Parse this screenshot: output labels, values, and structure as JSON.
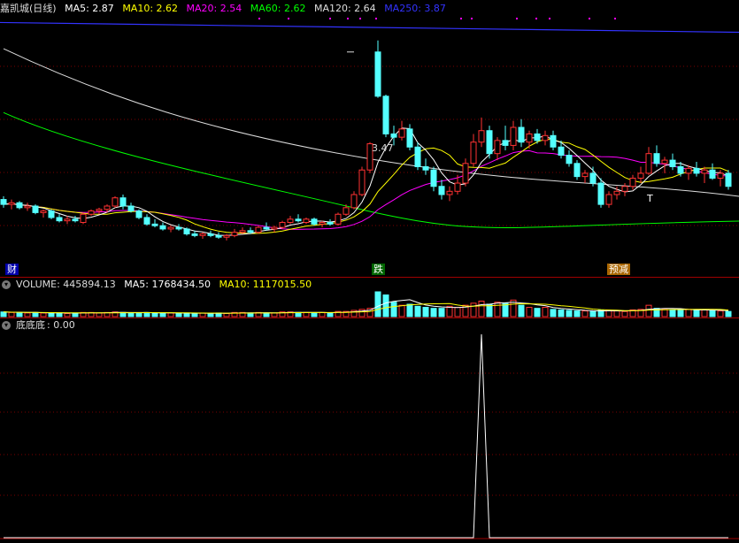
{
  "header": {
    "title": "嘉凯城(日线)",
    "ma": [
      {
        "label": "MA5: 2.87",
        "color": "#ffffff"
      },
      {
        "label": "MA10: 2.62",
        "color": "#ffff00"
      },
      {
        "label": "MA20: 2.54",
        "color": "#ff00ff"
      },
      {
        "label": "MA60: 2.62",
        "color": "#00ff00"
      },
      {
        "label": "MA120: 2.64",
        "color": "#dddddd"
      },
      {
        "label": "MA250: 3.87",
        "color": "#3333ff"
      }
    ]
  },
  "volume_header": {
    "name": "VOLUME: 445894.13",
    "ma5": "MA5: 1768434.50",
    "ma10": "MA10: 1117015.50"
  },
  "indicator_header": {
    "name": "底底底",
    "value": ": 0.00"
  },
  "tags": {
    "cai": "财",
    "die": "跌",
    "yujian": "预减",
    "high_label": "3.47",
    "t_label": "T"
  },
  "colors": {
    "up": "#ff3232",
    "down": "#54ffff",
    "grid": "#7a0000",
    "ma5": "#ffffff",
    "ma10": "#ffff00",
    "ma20": "#ff00ff",
    "ma60": "#00ff00",
    "ma120": "#dddddd",
    "ma250": "#3333ff"
  },
  "chart_data": [
    {
      "type": "candlestick",
      "title": "嘉凯城(日线)",
      "ylim": [
        2.12,
        3.62
      ],
      "candles": [
        [
          2.5,
          2.52,
          2.45,
          2.47
        ],
        [
          2.47,
          2.5,
          2.44,
          2.48
        ],
        [
          2.48,
          2.49,
          2.44,
          2.45
        ],
        [
          2.45,
          2.48,
          2.43,
          2.46
        ],
        [
          2.46,
          2.47,
          2.41,
          2.42
        ],
        [
          2.42,
          2.44,
          2.39,
          2.43
        ],
        [
          2.43,
          2.44,
          2.38,
          2.39
        ],
        [
          2.39,
          2.41,
          2.36,
          2.37
        ],
        [
          2.37,
          2.4,
          2.35,
          2.38
        ],
        [
          2.38,
          2.4,
          2.36,
          2.37
        ],
        [
          2.36,
          2.42,
          2.35,
          2.41
        ],
        [
          2.41,
          2.44,
          2.4,
          2.43
        ],
        [
          2.43,
          2.45,
          2.41,
          2.44
        ],
        [
          2.44,
          2.47,
          2.42,
          2.46
        ],
        [
          2.46,
          2.52,
          2.45,
          2.51
        ],
        [
          2.51,
          2.53,
          2.44,
          2.46
        ],
        [
          2.46,
          2.48,
          2.42,
          2.43
        ],
        [
          2.43,
          2.44,
          2.38,
          2.39
        ],
        [
          2.39,
          2.41,
          2.34,
          2.35
        ],
        [
          2.35,
          2.38,
          2.33,
          2.34
        ],
        [
          2.34,
          2.36,
          2.31,
          2.32
        ],
        [
          2.32,
          2.34,
          2.3,
          2.33
        ],
        [
          2.33,
          2.35,
          2.31,
          2.32
        ],
        [
          2.32,
          2.33,
          2.28,
          2.29
        ],
        [
          2.29,
          2.31,
          2.27,
          2.28
        ],
        [
          2.28,
          2.3,
          2.26,
          2.29
        ],
        [
          2.29,
          2.31,
          2.27,
          2.28
        ],
        [
          2.28,
          2.3,
          2.26,
          2.27
        ],
        [
          2.27,
          2.29,
          2.25,
          2.28
        ],
        [
          2.28,
          2.32,
          2.27,
          2.3
        ],
        [
          2.3,
          2.33,
          2.29,
          2.31
        ],
        [
          2.31,
          2.33,
          2.29,
          2.3
        ],
        [
          2.3,
          2.34,
          2.29,
          2.33
        ],
        [
          2.33,
          2.36,
          2.31,
          2.32
        ],
        [
          2.32,
          2.34,
          2.3,
          2.33
        ],
        [
          2.33,
          2.37,
          2.32,
          2.36
        ],
        [
          2.36,
          2.4,
          2.35,
          2.38
        ],
        [
          2.38,
          2.41,
          2.36,
          2.37
        ],
        [
          2.36,
          2.39,
          2.35,
          2.38
        ],
        [
          2.38,
          2.39,
          2.34,
          2.35
        ],
        [
          2.35,
          2.37,
          2.33,
          2.36
        ],
        [
          2.36,
          2.38,
          2.34,
          2.35
        ],
        [
          2.35,
          2.42,
          2.34,
          2.41
        ],
        [
          2.41,
          2.47,
          2.4,
          2.45
        ],
        [
          2.45,
          2.55,
          2.44,
          2.53
        ],
        [
          2.53,
          2.7,
          2.52,
          2.68
        ],
        [
          2.68,
          2.85,
          2.66,
          2.84
        ],
        [
          3.4,
          3.47,
          3.12,
          3.13
        ],
        [
          3.13,
          3.14,
          2.88,
          2.9
        ],
        [
          2.9,
          2.95,
          2.83,
          2.88
        ],
        [
          2.88,
          2.98,
          2.86,
          2.93
        ],
        [
          2.93,
          2.96,
          2.8,
          2.82
        ],
        [
          2.82,
          2.85,
          2.68,
          2.7
        ],
        [
          2.7,
          2.75,
          2.65,
          2.68
        ],
        [
          2.68,
          2.7,
          2.55,
          2.58
        ],
        [
          2.58,
          2.62,
          2.5,
          2.53
        ],
        [
          2.53,
          2.58,
          2.49,
          2.55
        ],
        [
          2.55,
          2.65,
          2.53,
          2.6
        ],
        [
          2.6,
          2.75,
          2.58,
          2.72
        ],
        [
          2.72,
          2.9,
          2.7,
          2.85
        ],
        [
          2.85,
          3.0,
          2.82,
          2.92
        ],
        [
          2.92,
          2.95,
          2.75,
          2.78
        ],
        [
          2.78,
          2.88,
          2.74,
          2.86
        ],
        [
          2.86,
          2.95,
          2.8,
          2.83
        ],
        [
          2.83,
          2.98,
          2.8,
          2.94
        ],
        [
          2.94,
          2.99,
          2.82,
          2.85
        ],
        [
          2.85,
          2.92,
          2.81,
          2.9
        ],
        [
          2.9,
          2.93,
          2.84,
          2.86
        ],
        [
          2.86,
          2.92,
          2.83,
          2.89
        ],
        [
          2.89,
          2.92,
          2.8,
          2.82
        ],
        [
          2.82,
          2.86,
          2.75,
          2.77
        ],
        [
          2.77,
          2.8,
          2.7,
          2.72
        ],
        [
          2.72,
          2.74,
          2.62,
          2.64
        ],
        [
          2.64,
          2.68,
          2.6,
          2.66
        ],
        [
          2.66,
          2.7,
          2.58,
          2.6
        ],
        [
          2.6,
          2.63,
          2.45,
          2.47
        ],
        [
          2.47,
          2.55,
          2.45,
          2.53
        ],
        [
          2.53,
          2.58,
          2.5,
          2.55
        ],
        [
          2.55,
          2.6,
          2.52,
          2.58
        ],
        [
          2.58,
          2.65,
          2.56,
          2.63
        ],
        [
          2.63,
          2.7,
          2.6,
          2.66
        ],
        [
          2.66,
          2.82,
          2.65,
          2.78
        ],
        [
          2.78,
          2.83,
          2.7,
          2.72
        ],
        [
          2.72,
          2.76,
          2.66,
          2.74
        ],
        [
          2.74,
          2.78,
          2.68,
          2.7
        ],
        [
          2.7,
          2.73,
          2.64,
          2.66
        ],
        [
          2.66,
          2.71,
          2.62,
          2.69
        ],
        [
          2.69,
          2.73,
          2.64,
          2.66
        ],
        [
          2.66,
          2.7,
          2.6,
          2.68
        ],
        [
          2.68,
          2.72,
          2.62,
          2.63
        ],
        [
          2.63,
          2.68,
          2.58,
          2.66
        ],
        [
          2.66,
          2.68,
          2.56,
          2.58
        ]
      ],
      "ma250": [
        3.58,
        3.52
      ],
      "ma120": [
        3.42,
        3.25,
        3.08,
        2.97,
        2.92
      ],
      "ma60": [
        3.03,
        2.93,
        2.75,
        2.62,
        2.55,
        2.53,
        2.52
      ]
    },
    {
      "type": "bar",
      "series": [
        {
          "name": "VOLUME",
          "values": [
            9,
            8,
            8,
            7,
            8,
            7,
            7,
            7,
            6,
            7,
            8,
            8,
            7,
            8,
            9,
            8,
            7,
            7,
            8,
            7,
            7,
            7,
            6,
            7,
            6,
            7,
            6,
            7,
            6,
            8,
            8,
            7,
            8,
            7,
            7,
            9,
            9,
            8,
            8,
            7,
            8,
            7,
            10,
            10,
            12,
            14,
            16,
            48,
            42,
            28,
            22,
            24,
            20,
            18,
            16,
            16,
            20,
            18,
            22,
            26,
            30,
            24,
            28,
            26,
            32,
            22,
            18,
            16,
            18,
            14,
            13,
            12,
            11,
            11,
            10,
            12,
            12,
            11,
            10,
            13,
            14,
            22,
            16,
            14,
            13,
            12,
            14,
            12,
            13,
            12,
            11,
            10
          ]
        }
      ]
    },
    {
      "type": "line",
      "series": [
        {
          "name": "底底底",
          "values": [
            0,
            0,
            0,
            0,
            0,
            0,
            0,
            0,
            0,
            0,
            0,
            0,
            0,
            0,
            0,
            0,
            0,
            0,
            0,
            0,
            0,
            0,
            0,
            0,
            0,
            0,
            0,
            0,
            0,
            0,
            0,
            0,
            0,
            0,
            0,
            0,
            0,
            0,
            0,
            0,
            0,
            0,
            0,
            0,
            0,
            0,
            0,
            0,
            0,
            0,
            0,
            0,
            0,
            0,
            0,
            0,
            0,
            0,
            0,
            0,
            1,
            0,
            0,
            0,
            0,
            0,
            0,
            0,
            0,
            0,
            0,
            0,
            0,
            0,
            0,
            0,
            0,
            0,
            0,
            0,
            0,
            0,
            0,
            0,
            0,
            0,
            0,
            0,
            0,
            0,
            0,
            0
          ]
        }
      ]
    }
  ]
}
